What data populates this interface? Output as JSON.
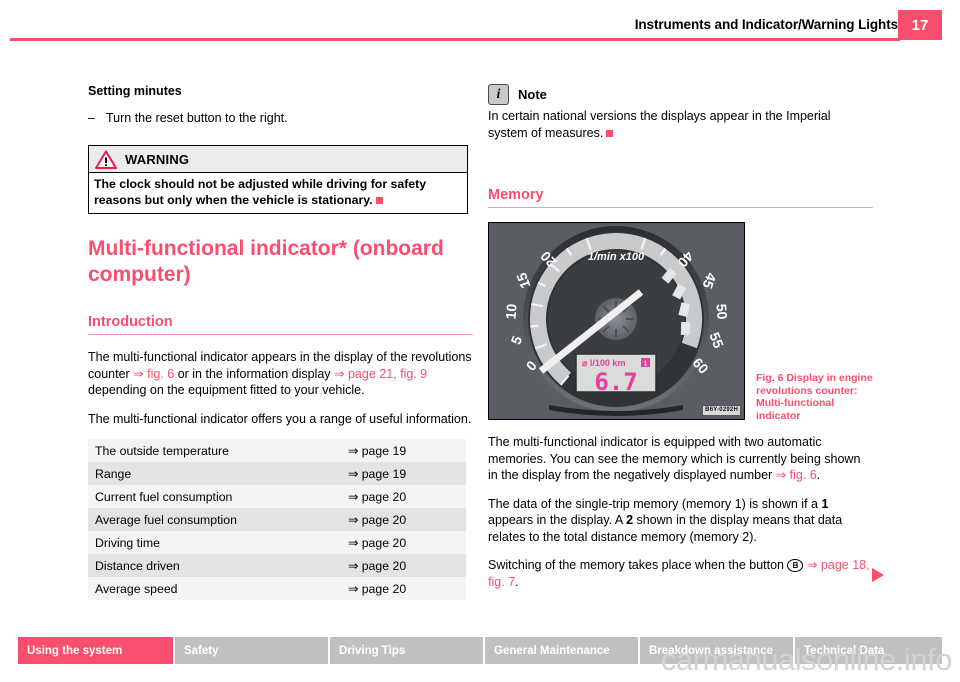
{
  "header": {
    "title": "Instruments and Indicator/Warning Lights",
    "page_number": "17",
    "accent_color": "#f94e6e"
  },
  "left_column": {
    "subhead": "Setting minutes",
    "dash_marker": "–",
    "instruction": "Turn the reset button to the right.",
    "warning": {
      "title": "WARNING",
      "icon": "warning-triangle-icon",
      "text": "The clock should not be adjusted while driving for safety reasons but only when the vehicle is stationary."
    },
    "big_heading": "Multi-functional indicator* (onboard computer)",
    "section_heading": "Introduction",
    "para1_a": "The multi-functional indicator appears in the display of the revolutions counter ",
    "para1_ref1": "⇒ fig. 6",
    "para1_b": " or in the information display ",
    "para1_ref2": "⇒ page 21, fig. 9",
    "para1_c": " depending on the equipment fitted to your vehicle.",
    "para2": "The multi-functional indicator offers you a range of useful information.",
    "table": {
      "rows": [
        {
          "label": "The outside temperature",
          "page": "⇒ page 19"
        },
        {
          "label": "Range",
          "page": "⇒ page 19"
        },
        {
          "label": "Current fuel consumption",
          "page": "⇒ page 20"
        },
        {
          "label": "Average fuel consumption",
          "page": "⇒ page 20"
        },
        {
          "label": "Driving time",
          "page": "⇒ page 20"
        },
        {
          "label": "Distance driven",
          "page": "⇒ page 20"
        },
        {
          "label": "Average speed",
          "page": "⇒ page 20"
        }
      ]
    }
  },
  "right_column": {
    "note": {
      "icon_letter": "i",
      "title": "Note",
      "text": "In certain national versions the displays appear in the Imperial system of measures."
    },
    "section_heading": "Memory",
    "figure": {
      "code": "B6Y-0292H",
      "caption": "Fig. 6   Display in engine revolutions counter:  Multi-functional indicator",
      "dial_unit": "1/min x100",
      "dial_ticks": [
        "0",
        "5",
        "10",
        "15",
        "20",
        "40",
        "45",
        "50",
        "55",
        "60"
      ],
      "lcd_label": "⌀ l/100 km",
      "lcd_value": "6.7",
      "lcd_memory_badge": "1"
    },
    "para1_a": "The multi-functional indicator is equipped with two automatic memories. You can see the memory which is currently being shown in the display from the negatively displayed number ",
    "para1_ref": "⇒ fig. 6",
    "para1_b": ".",
    "para2_a": "The data of the single-trip memory (memory 1) is shown if a ",
    "para2_b1": "1",
    "para2_c": " appears in the display. A ",
    "para2_b2": "2",
    "para2_d": " shown in the display means that data relates to the total distance memory (memory 2).",
    "para3_a": "Switching of the memory takes place when the button ",
    "para3_btn": "B",
    "para3_ref": "⇒ page 18, fig. 7",
    "para3_b": "."
  },
  "footer": {
    "tabs": [
      {
        "label": "Using the system",
        "active": true
      },
      {
        "label": "Safety",
        "active": false
      },
      {
        "label": "Driving Tips",
        "active": false
      },
      {
        "label": "General Maintenance",
        "active": false
      },
      {
        "label": "Breakdown assistance",
        "active": false
      },
      {
        "label": "Technical Data",
        "active": false
      }
    ]
  },
  "watermark": "carmanualsonline.info"
}
